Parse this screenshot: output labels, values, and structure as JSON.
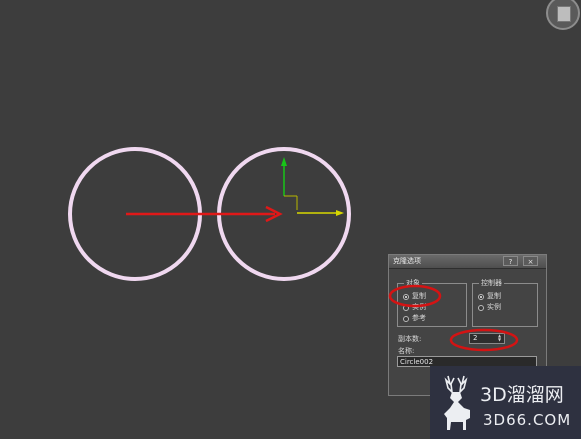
{
  "dialog": {
    "title": "克隆选项",
    "help_button": "?",
    "close_button": "×",
    "object_group": {
      "title": "对象",
      "options": [
        "复制",
        "实例",
        "参考"
      ],
      "selected": "复制"
    },
    "controller_group": {
      "title": "控制器",
      "options": [
        "复制",
        "实例"
      ],
      "selected": "复制"
    },
    "copies_label": "副本数:",
    "copies_value": "2",
    "name_label": "名称:",
    "name_value": "Circle002"
  },
  "watermark": {
    "main": "3D溜溜网",
    "sub": "3D66.COM"
  },
  "colors": {
    "viewport_bg": "#3d3d3d",
    "circle": "#f0d8f0",
    "arrow": "#e01818",
    "highlight": "#d41313",
    "gizmo_x": "#d8d800",
    "gizmo_y": "#18c418",
    "watermark_bg": "#2e3140"
  },
  "icons": [
    "viewcube-icon",
    "deer-logo-icon",
    "transform-gizmo-icon"
  ]
}
